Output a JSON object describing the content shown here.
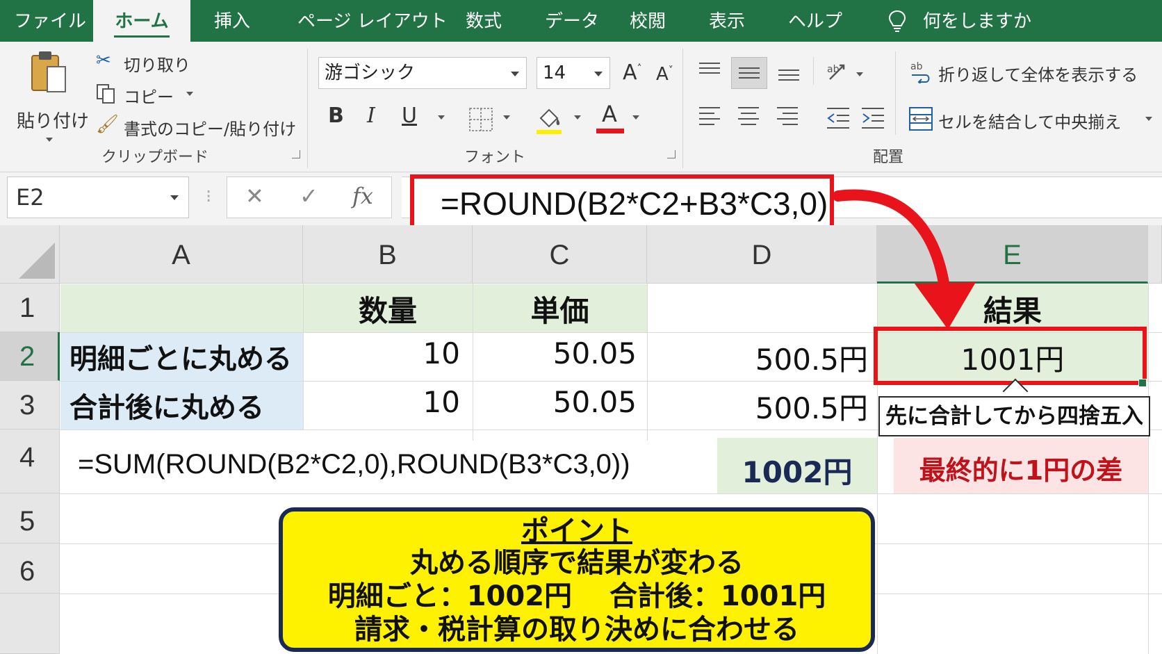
{
  "menu": {
    "tabs": [
      "ファイル",
      "ホーム",
      "挿入",
      "ページ レイアウト",
      "数式",
      "データ",
      "校閲",
      "表示",
      "ヘルプ"
    ],
    "tell_me": "何をしますか"
  },
  "ribbon": {
    "clipboard": {
      "paste": "貼り付け",
      "cut": "切り取り",
      "copy": "コピー",
      "format_painter": "書式のコピー/貼り付け",
      "label": "クリップボード"
    },
    "font": {
      "name": "游ゴシック",
      "size": "14",
      "bold": "B",
      "italic": "I",
      "underline": "U",
      "grow": "A",
      "shrink": "A",
      "font_color_glyph": "A",
      "label": "フォント",
      "highlight_color": "#ffee00",
      "font_color": "#e8131b"
    },
    "alignment": {
      "wrap_text": "折り返して全体を表示する",
      "merge_center": "セルを結合して中央揃え",
      "label": "配置"
    }
  },
  "formula_bar": {
    "name_box": "E2",
    "cancel_glyph": "✕",
    "enter_glyph": "✓",
    "fx": "fx",
    "formula": "=ROUND(B2*C2+B3*C3,0)"
  },
  "sheet": {
    "columns": [
      "A",
      "B",
      "C",
      "D",
      "E"
    ],
    "rows": [
      "1",
      "2",
      "3",
      "4",
      "5",
      "6"
    ],
    "selected_cell": "E2",
    "b1": "数量",
    "c1": "単価",
    "e1": "結果",
    "a2": "明細ごとに丸める",
    "b2": "10",
    "c2": "50.05",
    "d2": "500.5円",
    "e2": "1001円",
    "a3": "合計後に丸める",
    "b3": "10",
    "c3": "50.05",
    "d3": "500.5円",
    "a4": "=SUM(ROUND(B2*C2,0),ROUND(B3*C3,0))",
    "d4": "1002円",
    "e4": "最終的に1円の差"
  },
  "annotations": {
    "callout": "先に合計してから四捨五入",
    "point_title": "ポイント",
    "point_lines": [
      "丸める順序で結果が変わる",
      "明細ごと：1002円　 合計後：1001円",
      "請求・税計算の取り決めに合わせる"
    ],
    "accent_color": "#e8131b",
    "point_bg": "#fff200",
    "excel_green": "#217346",
    "difference_color": "#c0121b"
  }
}
